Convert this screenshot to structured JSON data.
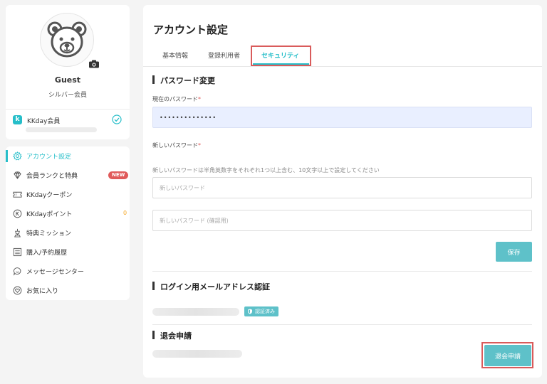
{
  "profile": {
    "name": "Guest",
    "rank": "シルバー会員",
    "membership_label": "KKday会員",
    "logo_letter": "k"
  },
  "menu": {
    "items": [
      {
        "label": "アカウント設定",
        "icon": "gear-icon",
        "active": true
      },
      {
        "label": "会員ランクと特典",
        "icon": "diamond-icon",
        "badge": "NEW"
      },
      {
        "label": "KKdayクーポン",
        "icon": "ticket-icon"
      },
      {
        "label": "KKdayポイント",
        "icon": "point-coin-icon",
        "count": "0"
      },
      {
        "label": "特典ミッション",
        "icon": "trophy-icon"
      },
      {
        "label": "購入/予約履歴",
        "icon": "list-icon"
      },
      {
        "label": "メッセージセンター",
        "icon": "chat-icon"
      },
      {
        "label": "お気に入り",
        "icon": "heart-icon"
      }
    ]
  },
  "main": {
    "title": "アカウント設定",
    "tabs": [
      {
        "label": "基本情報"
      },
      {
        "label": "登録利用者"
      },
      {
        "label": "セキュリティ",
        "active": true
      }
    ],
    "password": {
      "section_title": "パスワード変更",
      "current_label": "現在のパスワード",
      "current_value": "••••••••••••••",
      "new_label": "新しいパスワード",
      "required_mark": "*",
      "hint": "新しいパスワードは半角英数字をそれぞれ1つ以上含む、10文字以上で設定してください",
      "new_placeholder": "新しいパスワード",
      "confirm_placeholder": "新しいパスワード (確認用)",
      "save_label": "保存"
    },
    "email": {
      "section_title": "ログイン用メールアドレス認証",
      "verified_label": "認証済み"
    },
    "withdraw": {
      "section_title": "退会申請",
      "button_label": "退会申請"
    }
  },
  "colors": {
    "accent": "#26bec9",
    "button": "#5ec1c9",
    "highlight_border": "#d95b5b",
    "new_badge": "#e05a5a",
    "filled_input": "#e9efff"
  }
}
